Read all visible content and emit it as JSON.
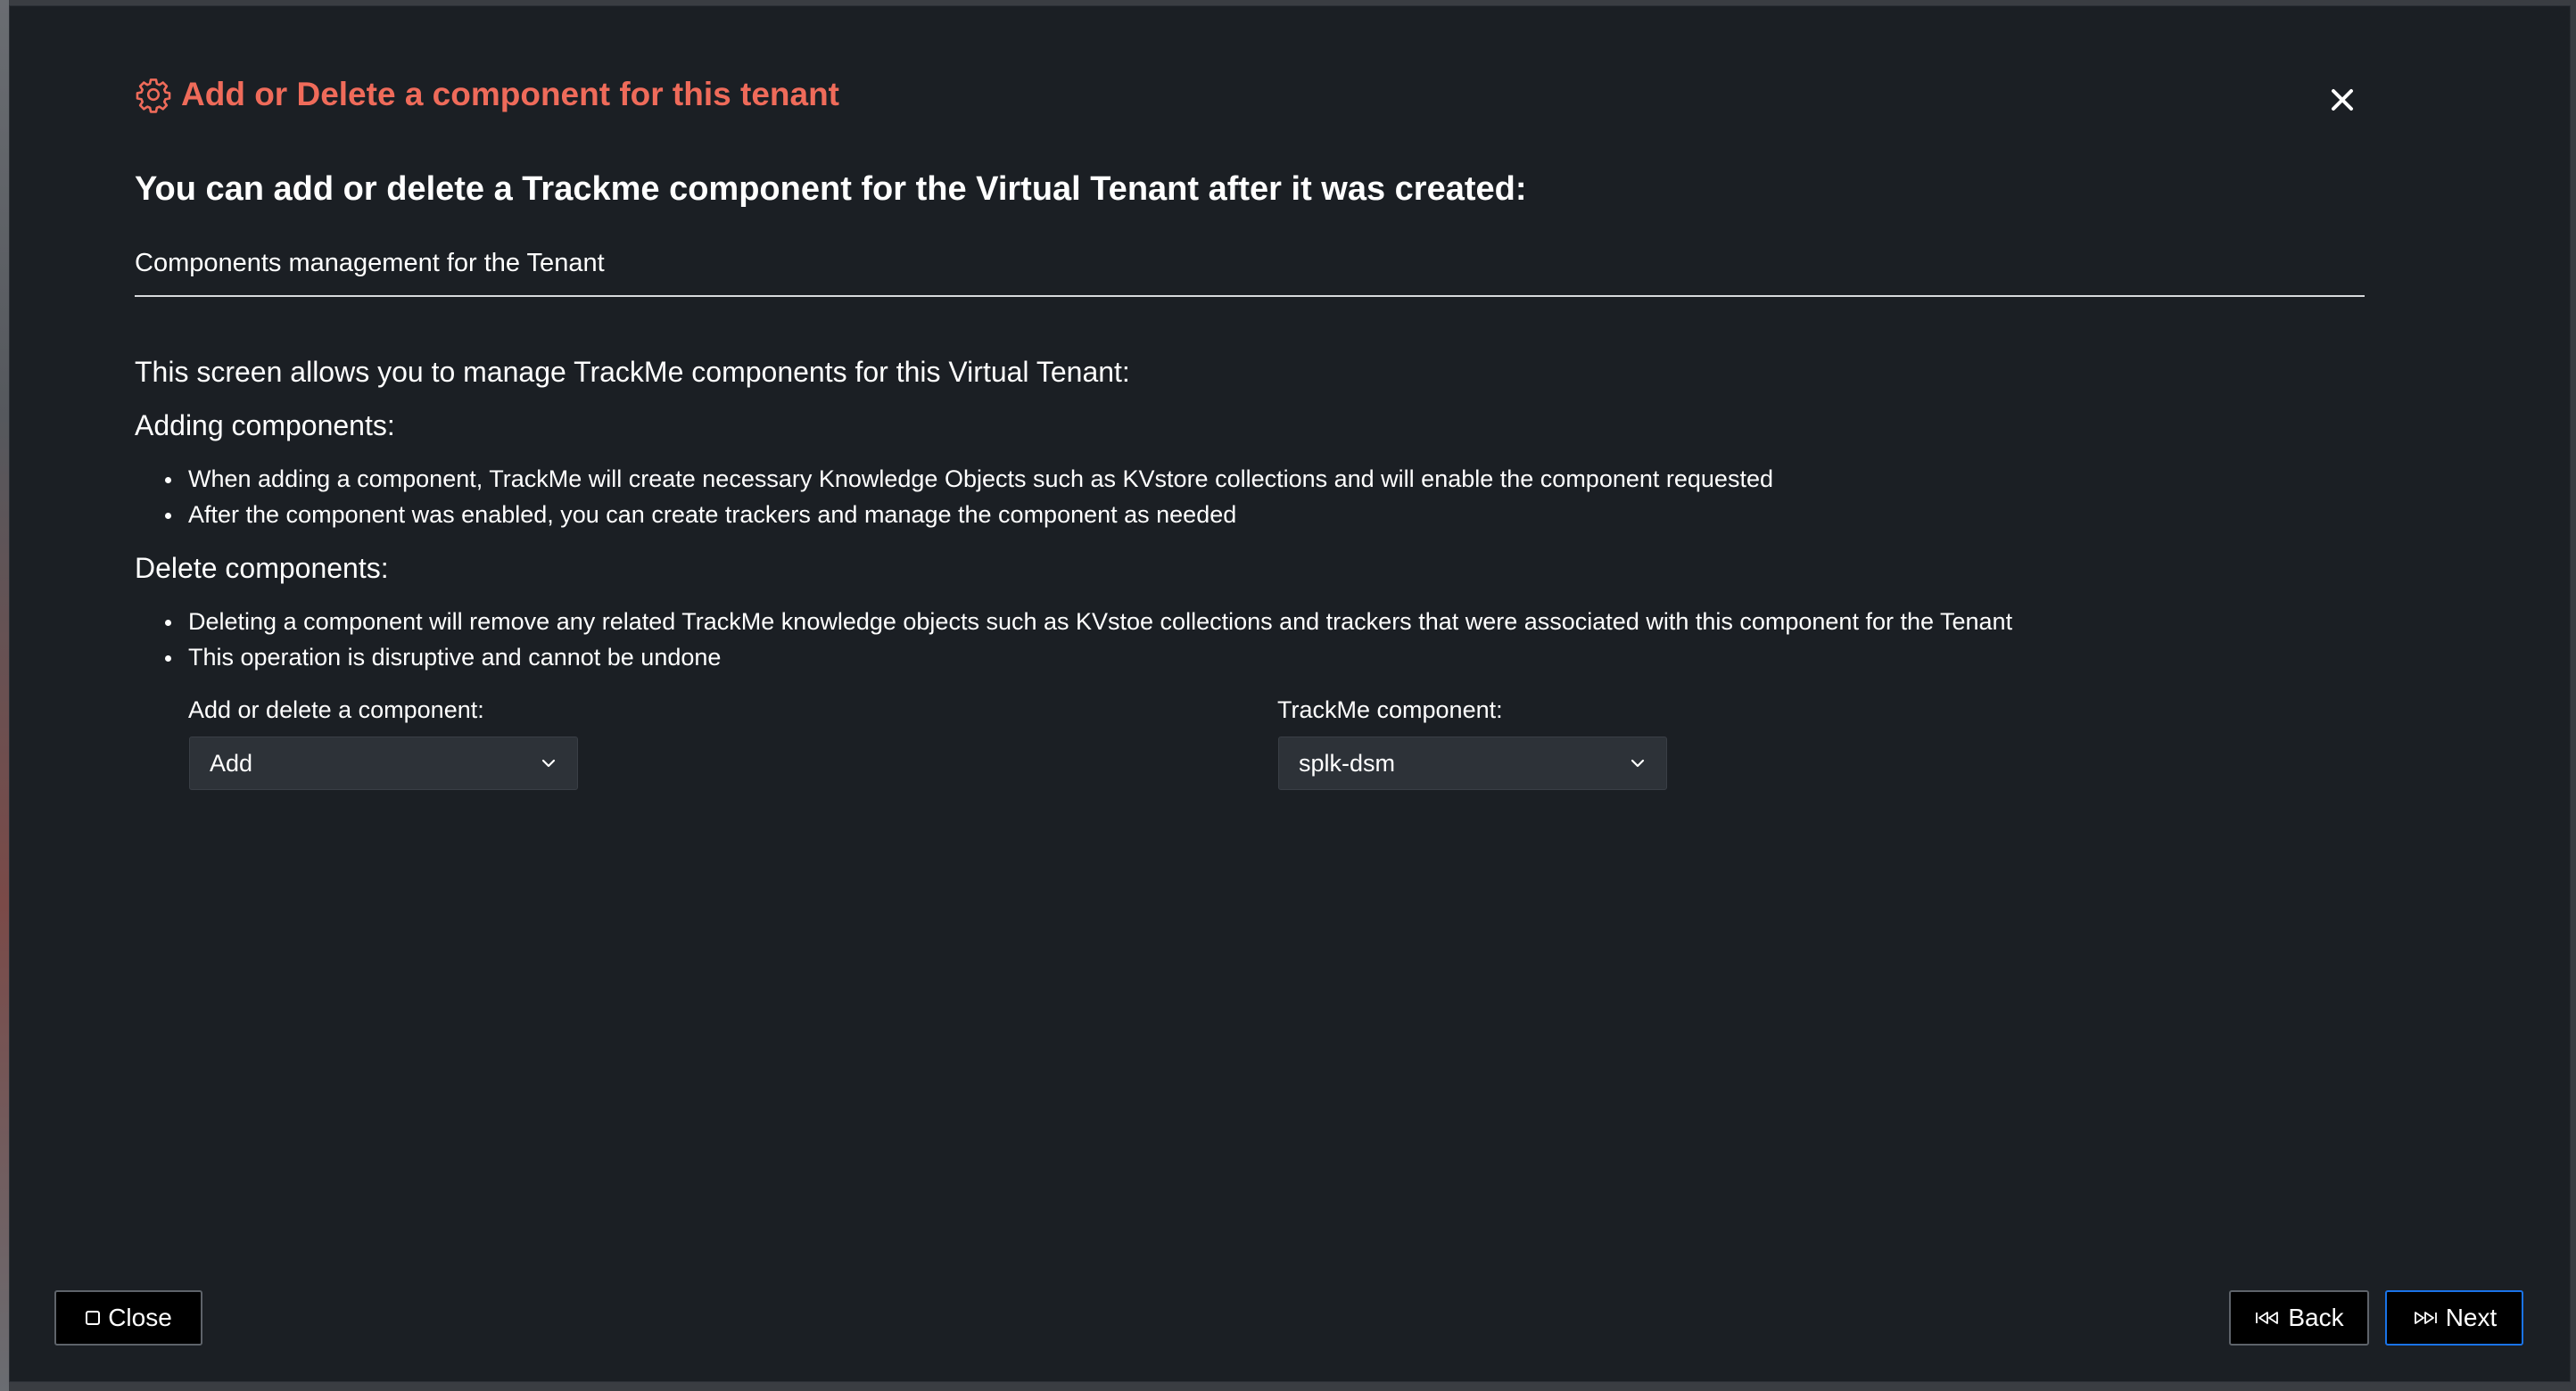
{
  "modal": {
    "title": "Add or Delete a component for this tenant",
    "title_icon": "gear-icon",
    "close_icon": "close-icon",
    "subtitle": "You can add or delete a Trackme component for the Virtual Tenant after it was created:",
    "section_label": "Components management for the Tenant",
    "intro": "This screen allows you to manage TrackMe components for this Virtual Tenant:",
    "adding": {
      "heading": "Adding components:",
      "items": [
        "When adding a component, TrackMe will create necessary Knowledge Objects such as KVstore collections and will enable the component requested",
        "After the component was enabled, you can create trackers and manage the component as needed"
      ]
    },
    "deleting": {
      "heading": "Delete components:",
      "items": [
        "Deleting a component will remove any related TrackMe knowledge objects such as KVstoe collections and trackers that were associated with this component for the Tenant",
        "This operation is disruptive and cannot be undone"
      ]
    },
    "fields": {
      "action": {
        "label": "Add or delete a component:",
        "value": "Add"
      },
      "component": {
        "label": "TrackMe component:",
        "value": "splk-dsm"
      }
    },
    "footer": {
      "close_label": "Close",
      "back_label": "Back",
      "next_label": "Next"
    }
  },
  "colors": {
    "accent": "#ef6b5a",
    "background": "#1b1f24",
    "select_bg": "#2d3238",
    "primary_border": "#1a73e8"
  }
}
